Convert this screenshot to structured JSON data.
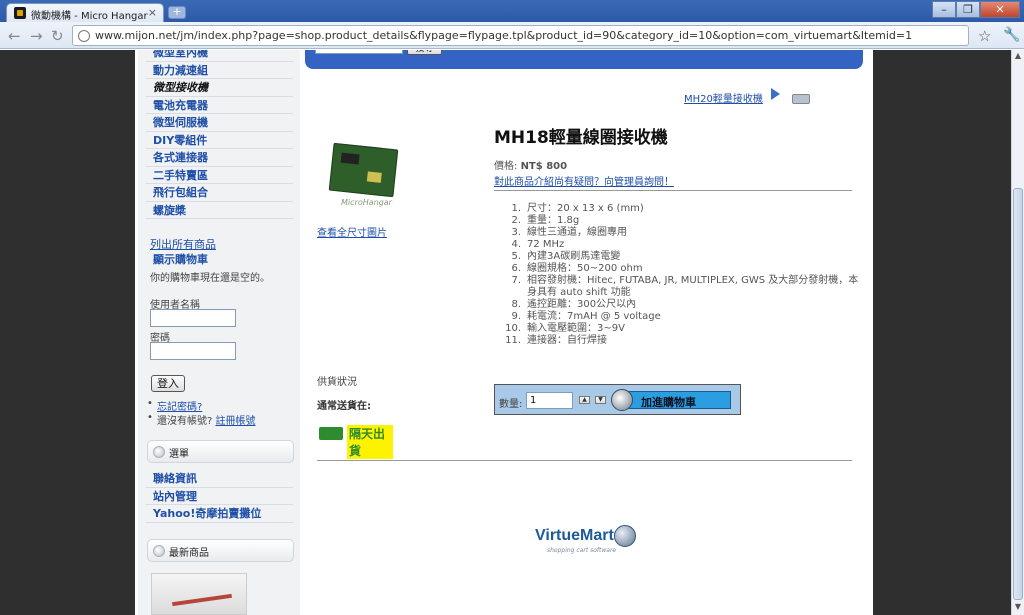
{
  "browser": {
    "tab_title": "微動機構 - Micro Hangar - ...",
    "tab_close": "×",
    "new_tab": "+",
    "url": "www.mijon.net/jm/index.php?page=shop.product_details&flypage=flypage.tpl&product_id=90&category_id=10&option=com_virtuemart&Itemid=1",
    "back": "←",
    "forward": "→",
    "reload": "↻",
    "window_minimize": "–",
    "window_restore": "❐",
    "window_close": "✕"
  },
  "sidebar": {
    "menu": [
      {
        "label": "微型室內機"
      },
      {
        "label": "動力減速組"
      },
      {
        "label": "微型接收機"
      },
      {
        "label": "電池充電器"
      },
      {
        "label": "微型伺服機"
      },
      {
        "label": "DIY零組件"
      },
      {
        "label": "各式連接器"
      },
      {
        "label": "二手特賣區"
      },
      {
        "label": "飛行包組合"
      },
      {
        "label": "螺旋槳"
      }
    ],
    "list_all": "列出所有商品",
    "show_cart": "顯示購物車",
    "cart_status": "你的購物車現在還是空的。",
    "username_label": "使用者名稱",
    "password_label": "密碼",
    "login_button": "登入",
    "forgot_password": "忘記密碼?",
    "no_account_text": "還沒有帳號?",
    "register_link": "註冊帳號",
    "module_menu": "選單",
    "links": [
      {
        "label": "聯絡資訊"
      },
      {
        "label": "站內管理"
      },
      {
        "label": "Yahoo!奇摩拍賣攤位"
      }
    ],
    "module_latest": "最新商品"
  },
  "main": {
    "search_button": "搜尋",
    "next_product": "MH20輕量接收機",
    "product_title": "MH18輕量線圈接收機",
    "price_label": "價格:",
    "price_value": "NT$ 800",
    "ask_link": "對此商品介紹尚有疑問？向管理員詢問！",
    "fullsize_link": "查看全尺寸圖片",
    "image_caption": "MicroHangar",
    "specs": [
      {
        "num": "1.",
        "text": "尺寸：20 x 13 x 6 (mm)"
      },
      {
        "num": "2.",
        "text": "重量：1.8g"
      },
      {
        "num": "3.",
        "text": "線性三通道，線圈專用"
      },
      {
        "num": "4.",
        "text": "72 MHz"
      },
      {
        "num": "5.",
        "text": "內建3A碳刷馬達電變"
      },
      {
        "num": "6.",
        "text": "線圈規格：50~200 ohm"
      },
      {
        "num": "7.",
        "text": "相容發射機：Hitec, FUTABA, JR, MULTIPLEX, GWS 及大部分發射機，本身具有 auto shift 功能"
      },
      {
        "num": "8.",
        "text": "遙控距離：300公尺以內"
      },
      {
        "num": "9.",
        "text": "耗電流：7mAH @ 5 voltage"
      },
      {
        "num": "10.",
        "text": "輸入電壓範圍：3~9V"
      },
      {
        "num": "11.",
        "text": "連接器：自行焊接"
      }
    ],
    "stock_label": "供貨狀況",
    "ship_label": "通常送貨在:",
    "ship_text": "隔天出貨",
    "qty_label": "數量:",
    "qty_value": "1",
    "qty_up": "▲",
    "qty_down": "▼",
    "add_to_cart": "加進購物車",
    "powered_by": "VirtueMart",
    "powered_sub": "shopping cart software"
  },
  "colors": {
    "link": "#1f4fa8",
    "header_blue": "#3563c4",
    "cart_box": "#a9c9e8",
    "add_button": "#2a9ee0"
  }
}
